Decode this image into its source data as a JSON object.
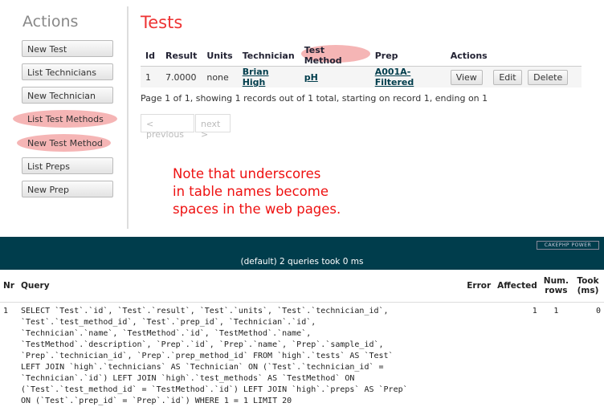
{
  "sidebar": {
    "heading": "Actions",
    "items": [
      {
        "label": "New Test"
      },
      {
        "label": "List Technicians"
      },
      {
        "label": "New Technician"
      },
      {
        "label": "List Test Methods"
      },
      {
        "label": "New Test Method"
      },
      {
        "label": "List Preps"
      },
      {
        "label": "New Prep"
      }
    ]
  },
  "main": {
    "title": "Tests",
    "columns": [
      "Id",
      "Result",
      "Units",
      "Technician",
      "Test Method",
      "Prep",
      "Actions"
    ],
    "rows": [
      {
        "id": "1",
        "result": "7.0000",
        "units": "none",
        "technician": "Brian High",
        "test_method": "pH",
        "prep": "A001A-Filtered",
        "actions": [
          "View",
          "Edit",
          "Delete"
        ]
      }
    ],
    "paging_text": "Page 1 of 1, showing 1 records out of 1 total, starting on record 1, ending on 1",
    "prev_label": "< previous",
    "next_label": "next >"
  },
  "annotation": {
    "text": "Note that underscores\nin table names become\nspaces in the web pages.",
    "color": "#e11111"
  },
  "sql_log": {
    "badge": "CAKEPHP POWER",
    "summary": "(default) 2 queries took 0 ms",
    "columns": [
      "Nr",
      "Query",
      "Error",
      "Affected",
      "Num. rows",
      "Took (ms)"
    ],
    "rows": [
      {
        "nr": "1",
        "query": "SELECT `Test`.`id`, `Test`.`result`, `Test`.`units`, `Test`.`technician_id`,\n`Test`.`test_method_id`, `Test`.`prep_id`, `Technician`.`id`,\n`Technician`.`name`, `TestMethod`.`id`, `TestMethod`.`name`,\n`TestMethod`.`description`, `Prep`.`id`, `Prep`.`name`, `Prep`.`sample_id`,\n`Prep`.`technician_id`, `Prep`.`prep_method_id` FROM `high`.`tests` AS `Test`\nLEFT JOIN `high`.`technicians` AS `Technician` ON (`Test`.`technician_id` =\n`Technician`.`id`) LEFT JOIN `high`.`test_methods` AS `TestMethod` ON\n(`Test`.`test_method_id` = `TestMethod`.`id`) LEFT JOIN `high`.`preps` AS `Prep`\nON (`Test`.`prep_id` = `Prep`.`id`) WHERE 1 = 1 LIMIT 20",
        "error": "",
        "affected": "1",
        "num_rows": "1",
        "took": "0"
      }
    ],
    "bar_color": "#003d4c"
  }
}
